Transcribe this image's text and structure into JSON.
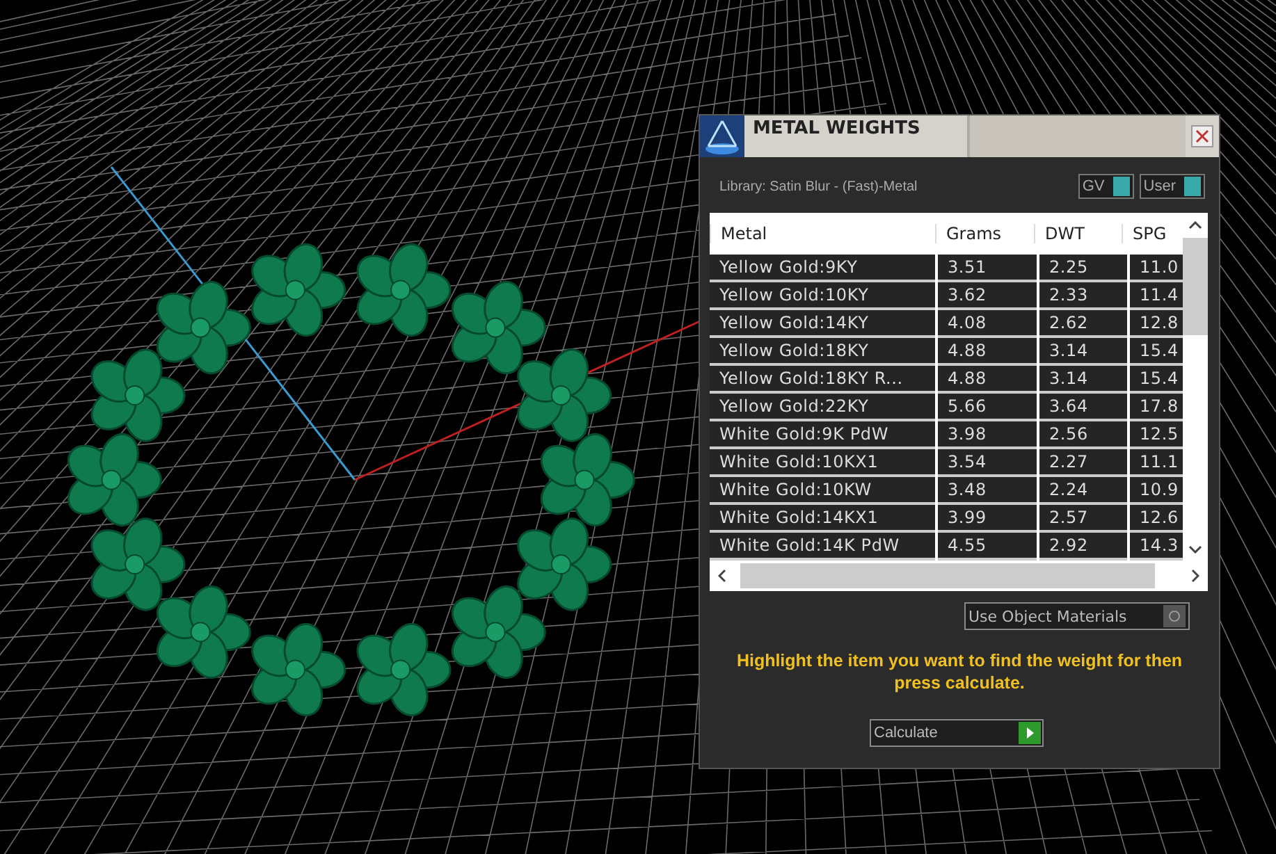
{
  "window": {
    "title": "METAL WEIGHTS"
  },
  "library": "Library: Satin Blur - (Fast)-Metal",
  "toggles": [
    {
      "label": "GV",
      "on": true
    },
    {
      "label": "User",
      "on": true
    }
  ],
  "table": {
    "columns": [
      "Metal",
      "Grams",
      "DWT",
      "SPG"
    ],
    "rows": [
      [
        "Yellow Gold:9KY",
        "3.51",
        "2.25",
        "11.0"
      ],
      [
        "Yellow Gold:10KY",
        "3.62",
        "2.33",
        "11.4"
      ],
      [
        "Yellow Gold:14KY",
        "4.08",
        "2.62",
        "12.8"
      ],
      [
        "Yellow Gold:18KY",
        "4.88",
        "3.14",
        "15.4"
      ],
      [
        "Yellow Gold:18KY R...",
        "4.88",
        "3.14",
        "15.4"
      ],
      [
        "Yellow Gold:22KY",
        "5.66",
        "3.64",
        "17.8"
      ],
      [
        "White Gold:9K PdW",
        "3.98",
        "2.56",
        "12.5"
      ],
      [
        "White Gold:10KX1",
        "3.54",
        "2.27",
        "11.1"
      ],
      [
        "White Gold:10KW",
        "3.48",
        "2.24",
        "10.9"
      ],
      [
        "White Gold:14KX1",
        "3.99",
        "2.57",
        "12.6"
      ],
      [
        "White Gold:14K PdW",
        "4.55",
        "2.92",
        "14.3"
      ]
    ]
  },
  "use_object_materials": {
    "label": "Use Object Materials",
    "on": false
  },
  "hint": "Highlight the item you want to find the weight for then press calculate.",
  "calculate_button": "Calculate"
}
